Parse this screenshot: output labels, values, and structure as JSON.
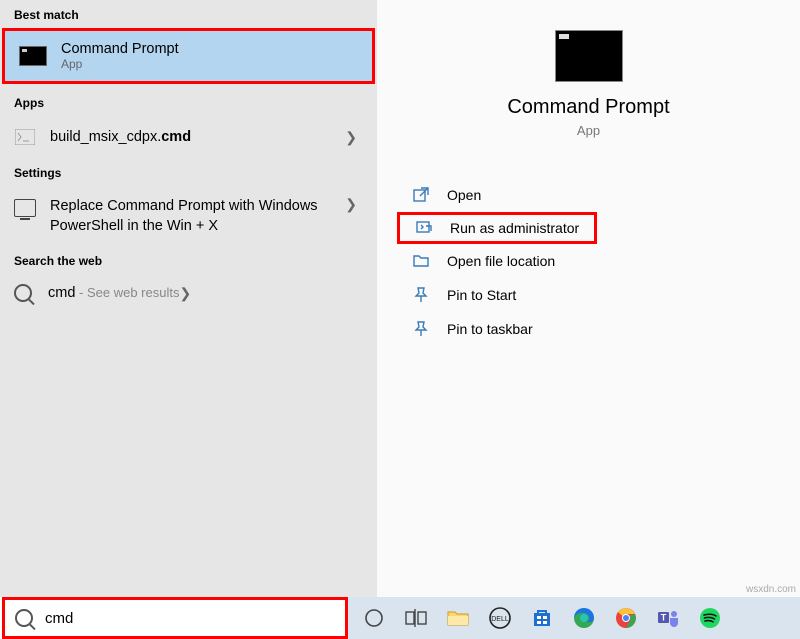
{
  "sections": {
    "best_match": "Best match",
    "apps": "Apps",
    "settings": "Settings",
    "web": "Search the web"
  },
  "best_match": {
    "title": "Command Prompt",
    "sub": "App"
  },
  "apps_result": {
    "title_prefix": "build_msix_cdpx.",
    "title_bold": "cmd"
  },
  "settings_result": {
    "text": "Replace Command Prompt with Windows PowerShell in the Win + X"
  },
  "web_result": {
    "term": "cmd",
    "hint": " - See web results"
  },
  "preview": {
    "title": "Command Prompt",
    "sub": "App"
  },
  "actions": {
    "open": "Open",
    "run_admin": "Run as administrator",
    "open_location": "Open file location",
    "pin_start": "Pin to Start",
    "pin_taskbar": "Pin to taskbar"
  },
  "search": {
    "value": "cmd"
  },
  "watermark": "wsxdn.com"
}
